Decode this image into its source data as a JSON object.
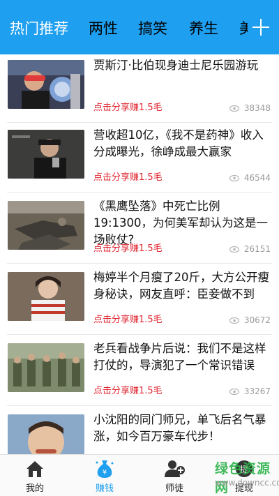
{
  "tabs": [
    {
      "label": "热门推荐",
      "active": true
    },
    {
      "label": "两性"
    },
    {
      "label": "搞笑"
    },
    {
      "label": "养生"
    },
    {
      "label": "美"
    }
  ],
  "add_icon": "plus-icon",
  "feed": [
    {
      "title": "贾斯汀·比伯现身迪士尼乐园游玩",
      "share": "点击分享赚1.5毛",
      "views": "38348"
    },
    {
      "title": "营收超10亿，《我不是药神》收入分成曝光，徐峥成最大赢家",
      "share": "点击分享赚1.5毛",
      "views": "46544"
    },
    {
      "title": "《黑鹰坠落》中死亡比例19:1300，为何美军却认为这是一场败仗?",
      "share": "点击分享赚1.5毛",
      "views": "26151"
    },
    {
      "title": "梅婷半个月瘦了20斤，大方公开瘦身秘诀，网友直呼：臣妾做不到",
      "share": "点击分享赚1.5毛",
      "views": "30672"
    },
    {
      "title": "老兵看战争片后说：我们不是这样打仗的，导演犯了一个常识错误",
      "share": "点击分享赚1.5毛",
      "views": "33267"
    },
    {
      "title": "小沈阳的同门师兄，单飞后名气暴涨，如今百万豪车代步！",
      "share": "",
      "views": ""
    }
  ],
  "bottom_nav": [
    {
      "label": "我的",
      "icon": "home-icon"
    },
    {
      "label": "赚钱",
      "icon": "money-bag-icon",
      "active": true
    },
    {
      "label": "师徒",
      "icon": "add-user-icon"
    },
    {
      "label": "提现",
      "icon": "withdraw-icon"
    }
  ],
  "watermark": {
    "text": "绿色资源网",
    "url": "www.downcc.com"
  },
  "colors": {
    "accent": "#1f9ff0",
    "share_red": "#e0242f",
    "watermark_green": "#2cb34a"
  }
}
